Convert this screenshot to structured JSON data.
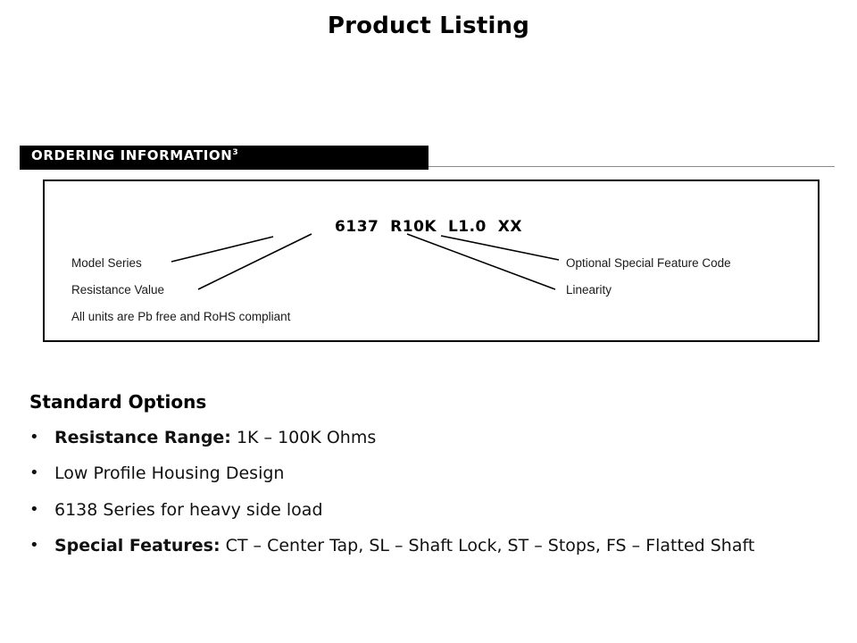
{
  "slide": {
    "title": "Product Listing"
  },
  "ordering": {
    "banner_label": "ORDERING INFORMATION",
    "banner_superscript": "3",
    "part_number": "6137  R10K  L1.0  XX",
    "callouts": {
      "model_series": "Model Series",
      "resistance_value": "Resistance Value",
      "pb_free_note": "All units are Pb free and RoHS compliant",
      "optional_feature": "Optional Special Feature Code",
      "linearity": "Linearity"
    },
    "colors": {
      "banner_background": "#000000",
      "banner_text": "#ffffff",
      "box_border": "#000000",
      "rule": "#8a8a8a"
    }
  },
  "standard_options": {
    "heading": "Standard Options",
    "bullet_mark": "•",
    "items": [
      {
        "bold_prefix": "Resistance Range:",
        "text": " 1K – 100K Ohms"
      },
      {
        "bold_prefix": "",
        "text": "Low Profile Housing Design"
      },
      {
        "bold_prefix": "",
        "text": "6138 Series for heavy side load"
      },
      {
        "bold_prefix": "Special Features:",
        "text": " CT – Center Tap, SL – Shaft Lock, ST – Stops, FS – Flatted Shaft"
      }
    ]
  }
}
